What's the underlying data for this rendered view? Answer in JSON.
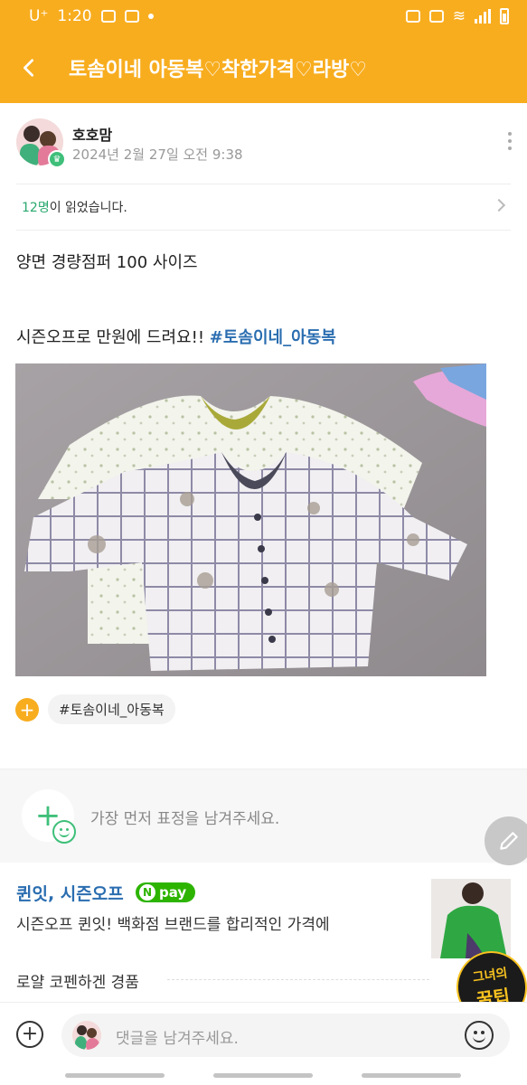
{
  "status_bar": {
    "carrier": "U⁺",
    "time": "1:20"
  },
  "app_bar": {
    "title": "토솜이네 아동복♡착한가격♡라방♡"
  },
  "post": {
    "author": "호호맘",
    "date": "2024년 2월 27일 오전 9:38",
    "read_count": "12명",
    "read_suffix": "이 읽었습니다.",
    "line1": "양면 경량점퍼 100 사이즈",
    "line2_text": "시즌오프로 만원에 드려요!! ",
    "line2_hashtag": "#토솜이네_아동복",
    "tag_chip": "#토솜이네_아동복"
  },
  "reaction": {
    "hint": "가장 먼저 표정을 남겨주세요."
  },
  "ad": {
    "title": "퀸잇, 시즌오프",
    "npay_label": "pay",
    "description": "시즌오프 퀸잇! 백화점 브랜드를 합리적인 가격에",
    "product": "로얄 코펜하겐 경품"
  },
  "badge": {
    "line1": "그녀의",
    "line2": "꿀팁"
  },
  "comment_bar": {
    "placeholder": "댓글을 남겨주세요."
  },
  "colors": {
    "brand": "#f8ad1f",
    "accent_green": "#2aa96f",
    "hashtag_blue": "#2a6db0",
    "npay_green": "#2db400"
  }
}
